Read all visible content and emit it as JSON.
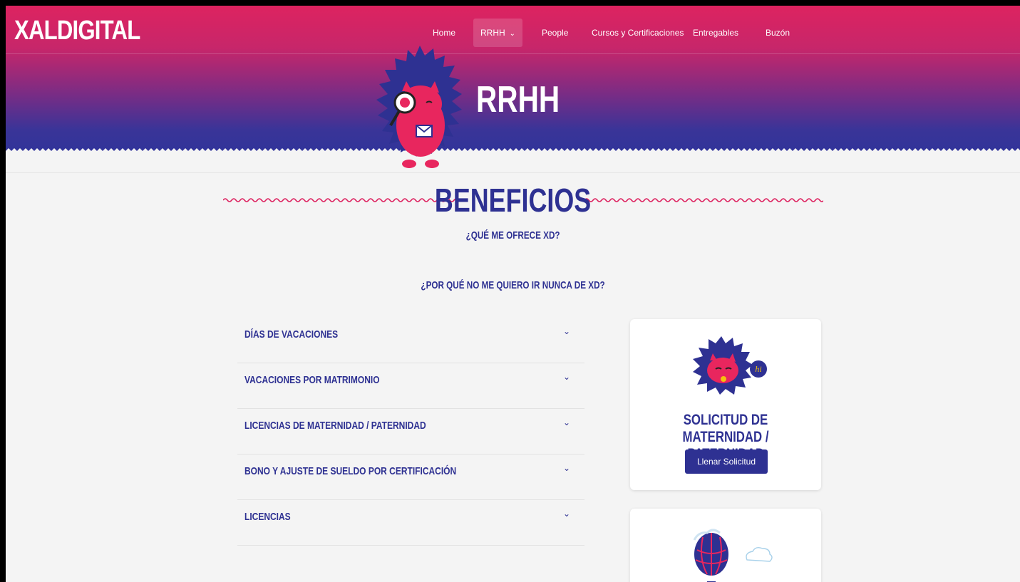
{
  "brand": {
    "logo_text": "XALDIGITAL"
  },
  "nav": {
    "items": [
      {
        "label": "Home"
      },
      {
        "label": "RRHH"
      },
      {
        "label": "People"
      },
      {
        "label": "Cursos y Certificaciones"
      },
      {
        "label": "Entregables"
      },
      {
        "label": "Buzón"
      }
    ],
    "active_index": 1
  },
  "hero": {
    "title": "RRHH"
  },
  "benefits": {
    "title": "BENEFICIOS",
    "question_1": "¿QUÉ ME OFRECE XD?",
    "question_2": "¿POR QUÉ NO ME QUIERO IR NUNCA DE XD?",
    "items": [
      {
        "label": "DÍAS DE VACACIONES"
      },
      {
        "label": "VACACIONES POR MATRIMONIO"
      },
      {
        "label": "LICENCIAS DE MATERNIDAD / PATERNIDAD"
      },
      {
        "label": "BONO Y AJUSTE DE SUELDO POR CERTIFICACIÓN"
      },
      {
        "label": "LICENCIAS"
      }
    ]
  },
  "cards": [
    {
      "title_line1": "SOLICITUD DE MATERNIDAD /",
      "title_line2": "PATERNIDAD",
      "button_label": "Llenar Solicitud",
      "bubble_text": "hi"
    }
  ],
  "colors": {
    "primary_navy": "#2e3192",
    "brand_pink": "#dd2360",
    "mascot_pink": "#e8265e",
    "background": "#f4f4f4"
  }
}
